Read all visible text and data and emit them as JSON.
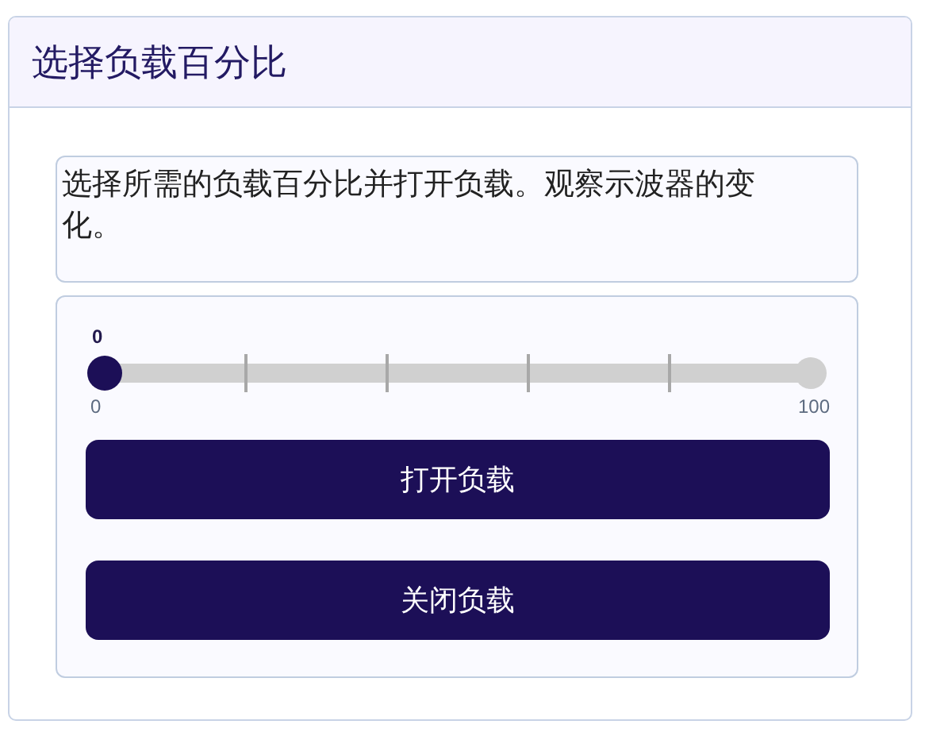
{
  "panel": {
    "title": "选择负载百分比"
  },
  "instruction": "选择所需的负载百分比并打开负载。观察示波器的变化。",
  "slider": {
    "value_label": "0",
    "level": 0,
    "min_label": "0",
    "max_label": "100"
  },
  "buttons": [
    {
      "label": "打开负载"
    },
    {
      "label": "关闭负载"
    }
  ]
}
